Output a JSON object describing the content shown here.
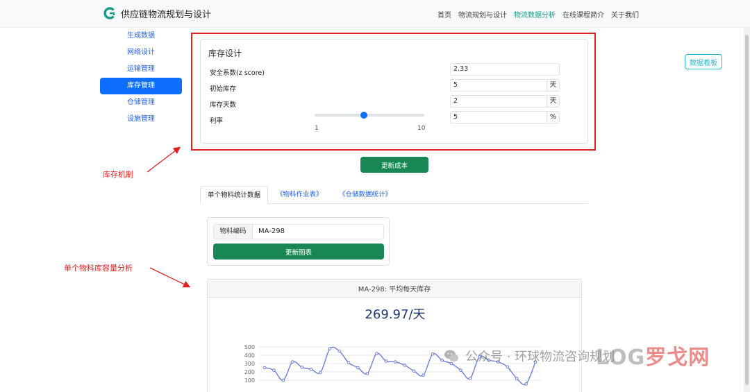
{
  "navbar": {
    "brand_title": "供应链物流规划与设计",
    "links": [
      "首页",
      "物流规划与设计",
      "物流数据分析",
      "在线课程简介",
      "关于我们"
    ],
    "active_link": "物流数据分析"
  },
  "sidebar": {
    "items": [
      "生成数据",
      "网络设计",
      "运输管理",
      "库存管理",
      "仓储管理",
      "设施管理"
    ],
    "active_item": "库存管理"
  },
  "dashboard_button": "数据看板",
  "inventory_design": {
    "title": "库存设计",
    "safety_factor": {
      "label": "安全系数(z score)",
      "value": "2.33"
    },
    "initial_stock": {
      "label": "初始库存",
      "value": "5",
      "unit": "天"
    },
    "stock_days": {
      "label": "库存天数",
      "value": "2",
      "unit": "天"
    },
    "interest_rate": {
      "label": "利率",
      "value": "5",
      "unit": "%",
      "slider_min": "1",
      "slider_max": "10",
      "slider_value": 5
    }
  },
  "update_cost_button": "更新成本",
  "tabs": [
    "单个物料统计数据",
    "《物料作业表》",
    "《仓储数据统计》"
  ],
  "material_query": {
    "code_label": "物料编码",
    "code_value": "MA-298",
    "update_chart_button": "更新图表"
  },
  "annotations": {
    "inventory_mechanism": "库存机制",
    "single_material_capacity": "单个物料库容量分析"
  },
  "watermark": {
    "text": "公众号 · 环球物流咨询规划",
    "logo_text": "LOG",
    "logo_suffix": "罗戈网"
  },
  "chart_data": {
    "type": "line",
    "title": "MA-298: 平均每天库存",
    "headline_value": "269.97/天",
    "y_ticks": [
      "500",
      "400",
      "300",
      "200",
      "100"
    ],
    "ylim": [
      0,
      500
    ],
    "values": [
      250,
      220,
      100,
      320,
      255,
      230,
      195,
      480,
      450,
      310,
      250,
      180,
      420,
      330,
      320,
      280,
      210,
      160,
      415,
      340,
      300,
      220,
      120,
      380,
      340,
      320,
      260,
      120,
      55,
      320
    ],
    "line_color": "#6b7fd7"
  }
}
